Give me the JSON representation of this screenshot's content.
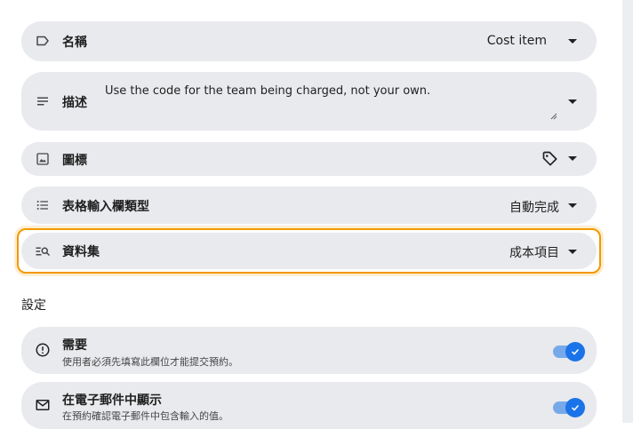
{
  "fields": {
    "name": {
      "label": "名稱",
      "value": "Cost item",
      "icon": "label-icon"
    },
    "description": {
      "label": "描述",
      "value": "Use the code for the team being charged, not your own.",
      "icon": "notes-icon"
    },
    "icon": {
      "label": "圖標",
      "value_icon": "tag-icon",
      "icon": "image-icon"
    },
    "input_type": {
      "label": "表格輸入欄類型",
      "value": "自動完成",
      "icon": "list-icon"
    },
    "dataset": {
      "label": "資料集",
      "value": "成本項目",
      "icon": "search-list-icon"
    }
  },
  "settings": {
    "title": "設定",
    "required": {
      "title": "需要",
      "subtitle": "使用者必須先填寫此欄位才能提交預約。",
      "enabled": true
    },
    "show_in_email": {
      "title": "在電子郵件中顯示",
      "subtitle": "在預約確認電子郵件中包含輸入的值。",
      "enabled": true
    }
  },
  "colors": {
    "accent": "#1a73e8",
    "focus": "#f29900",
    "row_bg": "#e8eaed"
  }
}
